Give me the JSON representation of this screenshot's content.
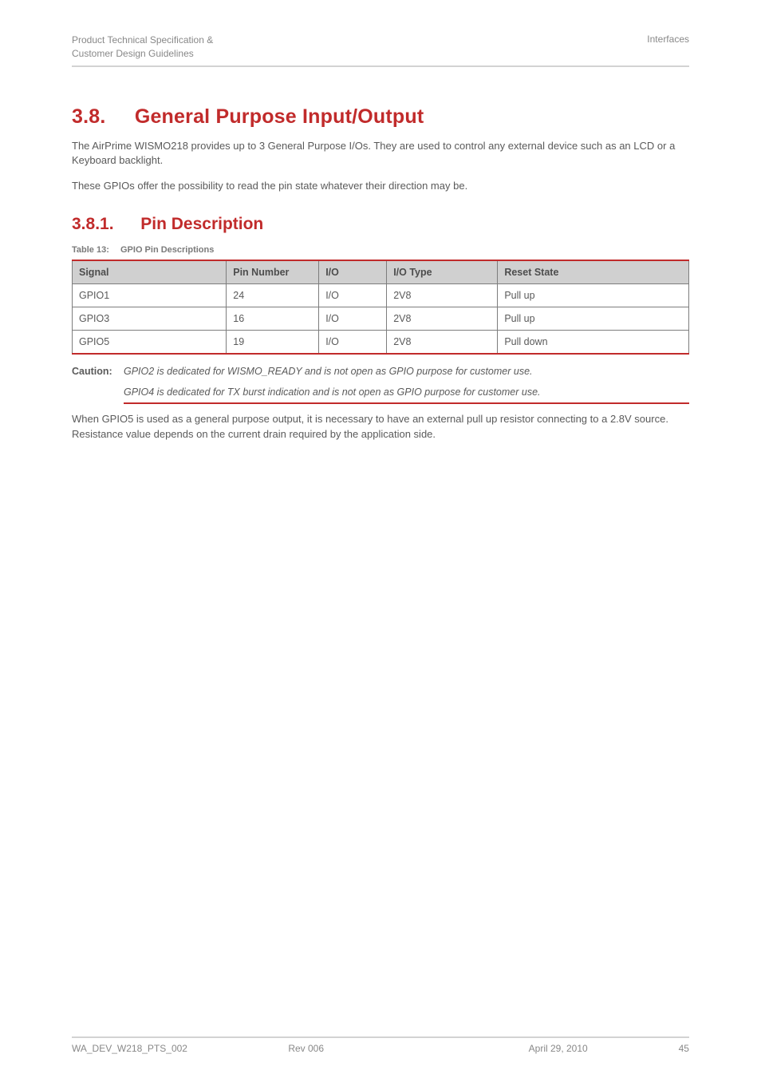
{
  "header": {
    "left_line1": "Product Technical Specification &",
    "left_line2": "Customer Design Guidelines",
    "right": "Interfaces"
  },
  "section1": {
    "number": "3.8.",
    "title": "General Purpose Input/Output",
    "p1": "The AirPrime WISMO218 provides up to 3 General Purpose I/Os. They are used to control any external device such as an LCD or a Keyboard backlight.",
    "p2": "These GPIOs offer the possibility to read the pin state whatever their direction may be."
  },
  "section2": {
    "number": "3.8.1.",
    "title": "Pin Description"
  },
  "table": {
    "caption_prefix": "Table 13:",
    "caption_text": "GPIO Pin Descriptions",
    "headers": {
      "signal": "Signal",
      "pin": "Pin Number",
      "io": "I/O",
      "type": "I/O Type",
      "reset": "Reset State"
    },
    "rows": [
      {
        "signal": "GPIO1",
        "pin": "24",
        "io": "I/O",
        "type": "2V8",
        "reset": "Pull up"
      },
      {
        "signal": "GPIO3",
        "pin": "16",
        "io": "I/O",
        "type": "2V8",
        "reset": "Pull up"
      },
      {
        "signal": "GPIO5",
        "pin": "19",
        "io": "I/O",
        "type": "2V8",
        "reset": "Pull down"
      }
    ]
  },
  "caution": {
    "label": "Caution:",
    "line1": "GPIO2 is dedicated for WISMO_READY and is not open as GPIO purpose for customer use.",
    "line2": "GPIO4 is dedicated for TX burst indication and is not open as GPIO purpose for customer use."
  },
  "after": {
    "p1": "When GPIO5 is used as a general purpose output, it is necessary to have an external pull up resistor connecting to a 2.8V source. Resistance value depends on the current drain required by the application side."
  },
  "footer": {
    "left": "WA_DEV_W218_PTS_002",
    "center": "Rev 006",
    "date": "April 29, 2010",
    "page": "45"
  }
}
